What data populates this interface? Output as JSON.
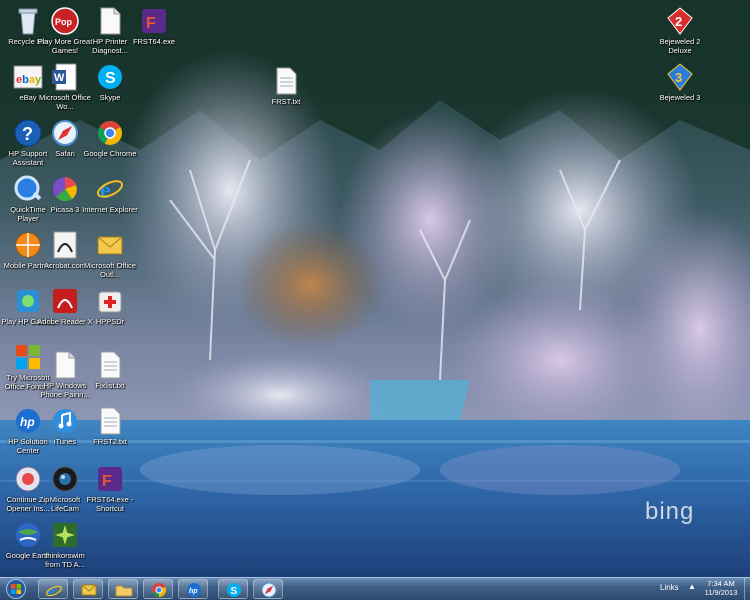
{
  "desktop": {
    "icons": [
      {
        "label": "Recycle Bin"
      },
      {
        "label": "Play More Great Games!"
      },
      {
        "label": "HP Printer Diagnost..."
      },
      {
        "label": "FRST64.exe"
      },
      {
        "label": "Bejeweled 2 Deluxe"
      },
      {
        "label": "eBay"
      },
      {
        "label": "Microsoft Office Wo..."
      },
      {
        "label": "Skype"
      },
      {
        "label": "FRST.txt"
      },
      {
        "label": "Bejeweled 3"
      },
      {
        "label": "HP Support Assistant"
      },
      {
        "label": "Safari"
      },
      {
        "label": "Google Chrome"
      },
      {
        "label": "QuickTime Player"
      },
      {
        "label": "Picasa 3"
      },
      {
        "label": "Internet Explorer"
      },
      {
        "label": "Mobile Partner"
      },
      {
        "label": "Acrobat.com"
      },
      {
        "label": "Microsoft Office Outl..."
      },
      {
        "label": "Play HP Games"
      },
      {
        "label": "Adobe Reader X"
      },
      {
        "label": "HPPSDr"
      },
      {
        "label": "Try Microsoft Office Fonts..."
      },
      {
        "label": "HP Windows Phone Pairin..."
      },
      {
        "label": "Fixlist.txt"
      },
      {
        "label": "HP Solution Center"
      },
      {
        "label": "iTunes"
      },
      {
        "label": "FRST2.txt"
      },
      {
        "label": "Continue Zip Opener Ins..."
      },
      {
        "label": "Microsoft LifeCam"
      },
      {
        "label": "FRST64.exe - Shortcut"
      },
      {
        "label": "Google Earth"
      },
      {
        "label": "thinkorswim from TD A..."
      }
    ],
    "watermark": "bing"
  },
  "taskbar": {
    "links_label": "Links",
    "tray_arrow": "▲",
    "clock_time": "7:34 AM",
    "clock_date": "11/9/2013",
    "pinned": [
      {
        "icon": "internet-explorer-icon"
      },
      {
        "icon": "outlook-icon"
      },
      {
        "icon": "folder-icon"
      },
      {
        "icon": "chrome-icon"
      },
      {
        "icon": "hp-icon"
      },
      {
        "icon": "skype-icon"
      },
      {
        "icon": "safari-icon"
      }
    ]
  },
  "colors": {
    "taskbar": "#3f5f86",
    "water": "#2f6fae",
    "forest": "#1f3a34"
  }
}
